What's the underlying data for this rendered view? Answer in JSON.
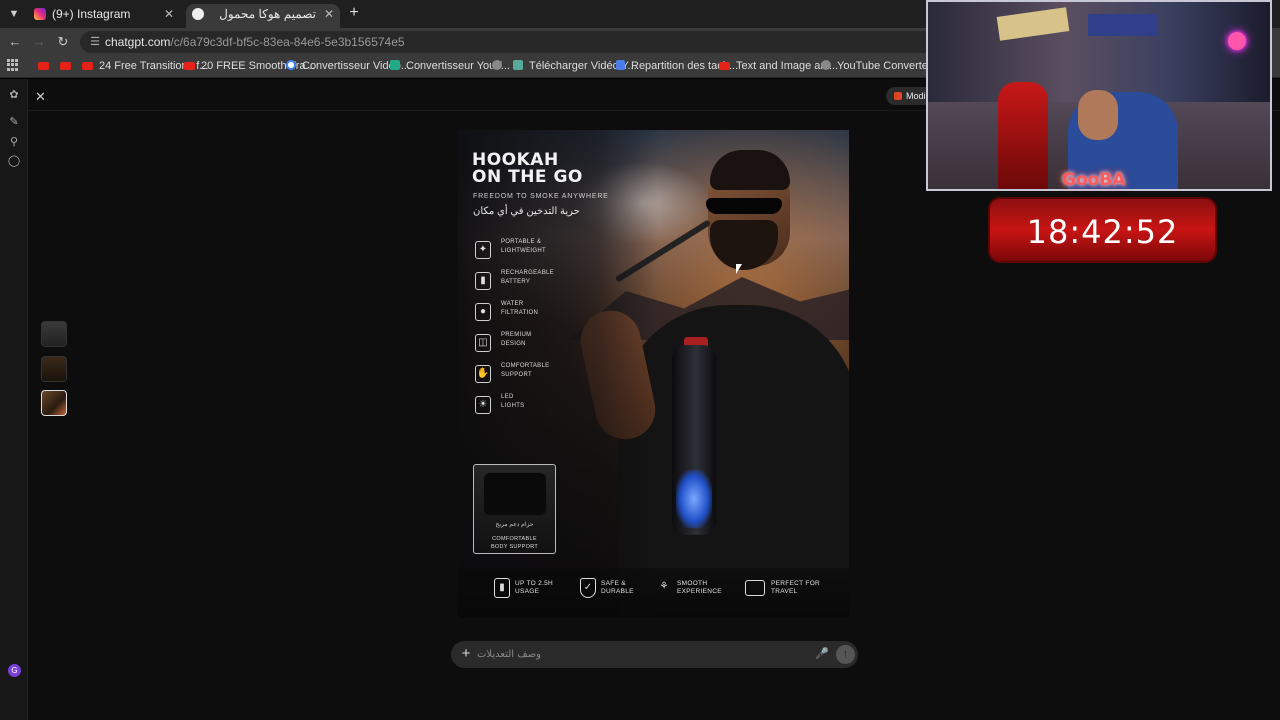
{
  "browser": {
    "tabs": [
      {
        "title": "(9+) Instagram",
        "active": false
      },
      {
        "title": "تصميم هوكا محمول",
        "active": true
      }
    ],
    "url_domain": "chatgpt.com",
    "url_path": "/c/6a79c3df-bf5c-83ea-84e6-5e3b156574e5",
    "bookmarks": [
      "24 Free Transitions f...",
      "20 FREE Smooth Tra...",
      "Convertisseur Video...",
      "Convertisseur YouT...",
      "Télécharger Vidéo Y...",
      "Repartition des tach...",
      "Text and Image ani...",
      "YouTube Converter..."
    ]
  },
  "app": {
    "model_chip": "Modi",
    "avatar_initial": "G",
    "composer_placeholder": "وصف التعديلات"
  },
  "poster": {
    "title_line1": "HOOKAH",
    "title_line2": "ON THE GO",
    "subtitle": "FREEDOM TO SMOKE ANYWHERE",
    "subtitle_ar": "حرية التدخين في أي مكان",
    "features": [
      {
        "line1": "PORTABLE &",
        "line2": "LIGHTWEIGHT",
        "icon": "feather-icon"
      },
      {
        "line1": "RECHARGEABLE",
        "line2": "BATTERY",
        "icon": "battery-icon"
      },
      {
        "line1": "WATER",
        "line2": "FILTRATION",
        "icon": "water-drop-icon"
      },
      {
        "line1": "PREMIUM",
        "line2": "DESIGN",
        "icon": "cube-icon"
      },
      {
        "line1": "COMFORTABLE",
        "line2": "SUPPORT",
        "icon": "hand-icon"
      },
      {
        "line1": "LED",
        "line2": "LIGHTS",
        "icon": "bulb-icon"
      }
    ],
    "strap_ar": "حزام دعم مريح",
    "strap_line1": "COMFORTABLE",
    "strap_line2": "BODY SUPPORT",
    "bottom_features": [
      {
        "line1": "UP TO 2.5H",
        "line2": "USAGE",
        "icon": "battery-icon"
      },
      {
        "line1": "SAFE &",
        "line2": "DURABLE",
        "icon": "shield-icon"
      },
      {
        "line1": "SMOOTH",
        "line2": "EXPERIENCE",
        "icon": "hookah-icon"
      },
      {
        "line1": "PERFECT FOR",
        "line2": "TRAVEL",
        "icon": "suitcase-icon"
      }
    ]
  },
  "overlay": {
    "streamer_logo": "GooBA",
    "clock": "18:42:52"
  }
}
